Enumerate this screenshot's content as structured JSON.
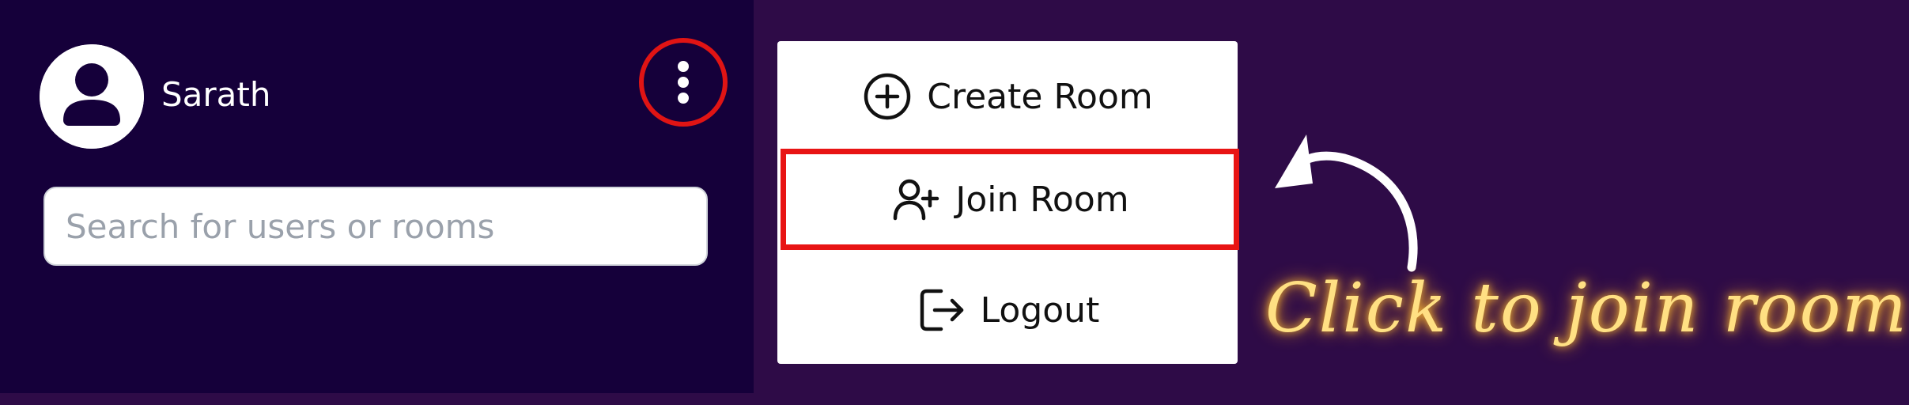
{
  "user": {
    "name": "Sarath"
  },
  "search": {
    "placeholder": "Search for users or rooms"
  },
  "menu": {
    "items": [
      {
        "label": "Create Room",
        "icon": "plus-circle-icon"
      },
      {
        "label": "Join Room",
        "icon": "user-plus-icon",
        "highlighted": true
      },
      {
        "label": "Logout",
        "icon": "logout-icon"
      }
    ]
  },
  "annotation": {
    "text": "Click to join room",
    "color": "#ffe083"
  },
  "colors": {
    "page_background": "#2e0b47",
    "panel_background": "#15003a",
    "highlight": "#e81414"
  }
}
